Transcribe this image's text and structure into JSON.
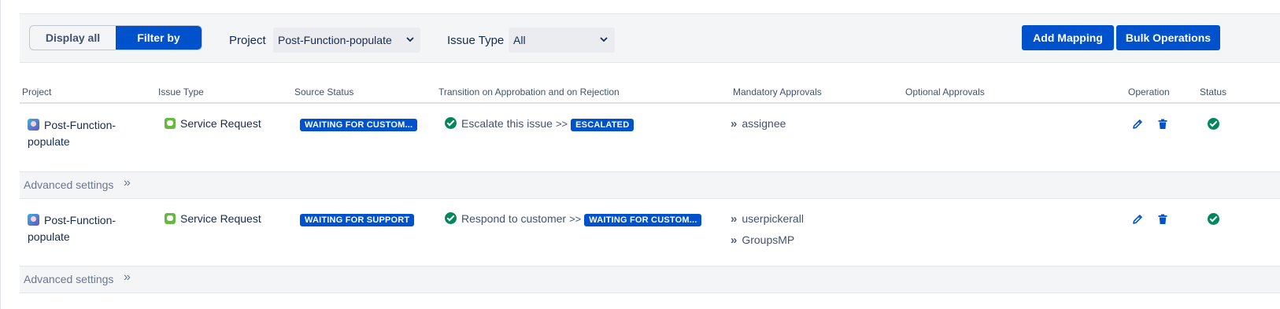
{
  "toolbar": {
    "display_all_label": "Display all",
    "filter_by_label": "Filter by",
    "project_label": "Project",
    "project_value": "Post-Function-populate",
    "issue_type_label": "Issue Type",
    "issue_type_value": "All",
    "add_mapping_label": "Add Mapping",
    "bulk_operations_label": "Bulk Operations"
  },
  "table": {
    "headers": {
      "project": "Project",
      "issue_type": "Issue Type",
      "source_status": "Source Status",
      "transition": "Transition on Approbation and on Rejection",
      "mandatory": "Mandatory Approvals",
      "optional": "Optional Approvals",
      "operation": "Operation",
      "status": "Status"
    },
    "rows": [
      {
        "project_line1": "Post-Function-",
        "project_line2": "populate",
        "issue_type": "Service Request",
        "source_status": "WAITING FOR CUSTOM...",
        "transition_name": "Escalate this issue",
        "transition_arrow": ">>",
        "target_status": "ESCALATED",
        "mandatory": [
          "assignee"
        ],
        "advanced_label": "Advanced settings"
      },
      {
        "project_line1": "Post-Function-",
        "project_line2": "populate",
        "issue_type": "Service Request",
        "source_status": "WAITING FOR SUPPORT",
        "transition_name": "Respond to customer",
        "transition_arrow": ">>",
        "target_status": "WAITING FOR CUSTOM...",
        "mandatory": [
          "userpickerall",
          "GroupsMP"
        ],
        "advanced_label": "Advanced settings"
      }
    ]
  },
  "icons": {
    "project": "project-avatar-icon",
    "issue_type": "service-request-icon",
    "transition": "check-circle-icon",
    "approval": "double-chevron-right-icon",
    "edit": "pencil-icon",
    "delete": "trash-icon",
    "status": "check-circle-icon",
    "dropdown": "chevron-down-icon"
  },
  "colors": {
    "primary": "#0052cc",
    "success": "#00875a",
    "service_request": "#63ba3c"
  }
}
